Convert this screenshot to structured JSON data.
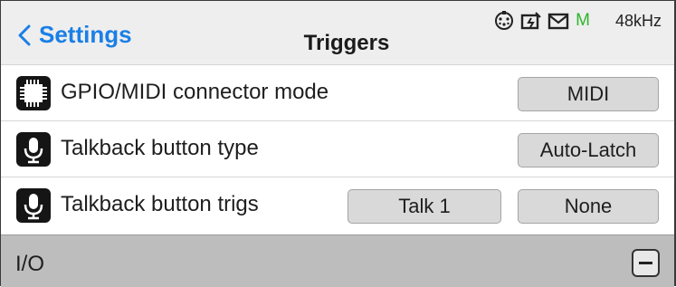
{
  "header": {
    "back_label": "Settings",
    "title": "Triggers",
    "status": {
      "icons": [
        "timecode-icon",
        "power-icon",
        "mail-icon"
      ],
      "meter_letter": "M",
      "meter_color": "#2db52d",
      "sample_rate": "48kHz"
    },
    "accent_color": "#1a7fe6"
  },
  "rows": [
    {
      "icon": "chip-icon",
      "label": "GPIO/MIDI connector mode",
      "value": "MIDI"
    },
    {
      "icon": "microphone-icon",
      "label": "Talkback button type",
      "value": "Auto-Latch"
    },
    {
      "icon": "microphone-icon",
      "label": "Talkback button trigs",
      "value_a": "Talk 1",
      "value_b": "None"
    }
  ],
  "section": {
    "label": "I/O",
    "collapse_icon": "minus-icon"
  }
}
